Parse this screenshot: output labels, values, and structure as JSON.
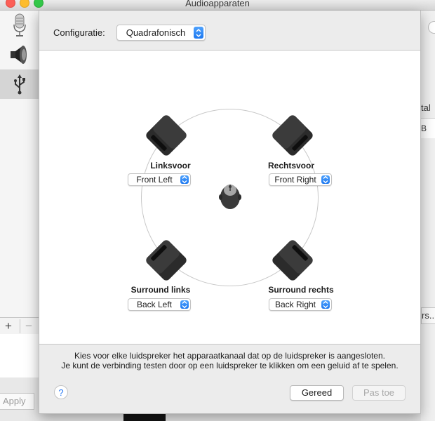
{
  "window": {
    "title": "Audioapparaten"
  },
  "sidebar": {
    "items": [
      {
        "icon": "microphone-icon"
      },
      {
        "icon": "speaker-icon"
      },
      {
        "icon": "usb-icon",
        "selected": true
      }
    ],
    "add_label": "+",
    "remove_label": "−"
  },
  "background": {
    "apply_label": "Apply",
    "right_text_1": "tal",
    "right_text_2": "B",
    "right_button": "rs..."
  },
  "sheet": {
    "config_label": "Configuratie:",
    "config_value": "Quadrafonisch",
    "speakers": {
      "front_left": {
        "label": "Linksvoor",
        "channel": "Front Left"
      },
      "front_right": {
        "label": "Rechtsvoor",
        "channel": "Front Right"
      },
      "surround_left": {
        "label": "Surround links",
        "channel": "Back Left"
      },
      "surround_right": {
        "label": "Surround rechts",
        "channel": "Back Right"
      }
    },
    "info_line_1": "Kies voor elke luidspreker het apparaatkanaal dat op de luidspreker is aangesloten.",
    "info_line_2": "Je kunt de verbinding testen door op een luidspreker te klikken om een geluid af te spelen.",
    "help_label": "?",
    "done_label": "Gereed",
    "apply_label": "Pas toe"
  },
  "colors": {
    "accent": "#1d78f0",
    "speaker": "#2b2b2b"
  }
}
